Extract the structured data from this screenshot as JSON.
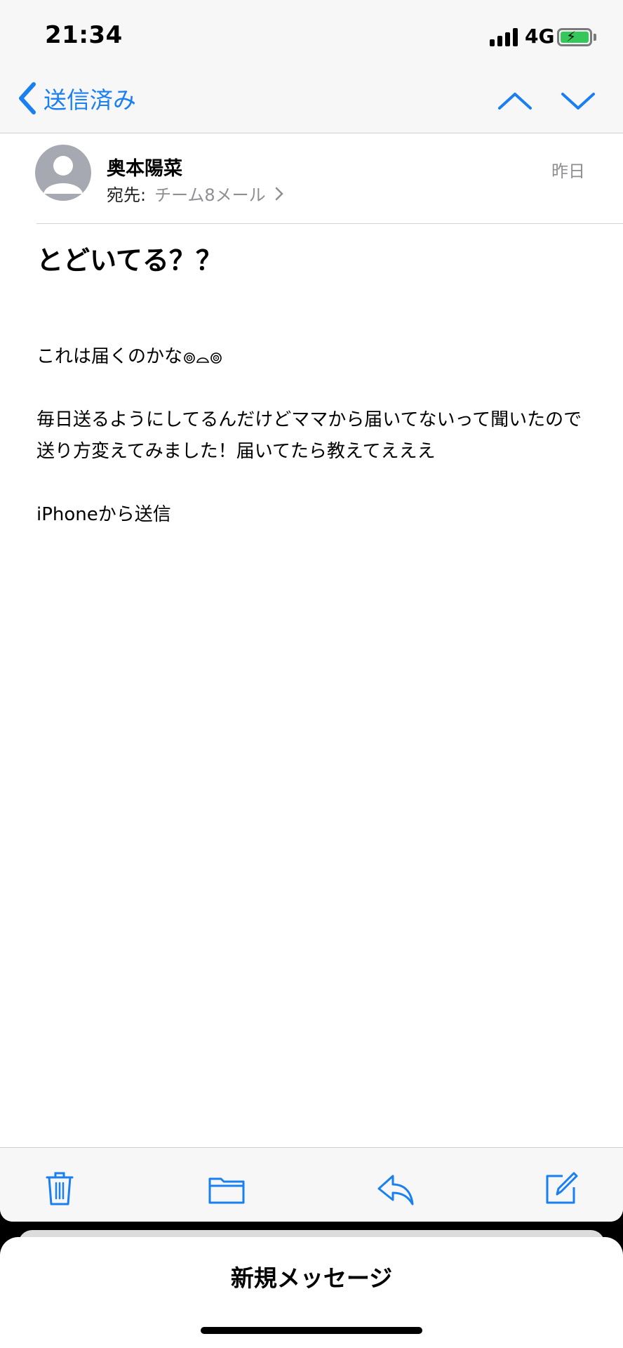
{
  "status_bar": {
    "time": "21:34",
    "network": "4G"
  },
  "nav": {
    "back_label": "送信済み"
  },
  "message": {
    "sender": "奥本陽菜",
    "to_label": "宛先:",
    "to_value": "チーム8メール",
    "date": "昨日",
    "subject": "とどいてる？？",
    "body_line1": "これは届くのかな",
    "body_paragraph2": "毎日送るようにしてるんだけどママから届いてないって聞いたので送り方変えてみました！届いてたら教えてえええ",
    "signature": "iPhoneから送信"
  },
  "toolbar": {
    "items": [
      "trash-icon",
      "folder-icon",
      "reply-icon",
      "compose-icon"
    ]
  },
  "sheet": {
    "title": "新規メッセージ"
  },
  "colors": {
    "accent": "#1a7ff0",
    "battery": "#34c759",
    "secondary_text": "#8e8e93"
  }
}
